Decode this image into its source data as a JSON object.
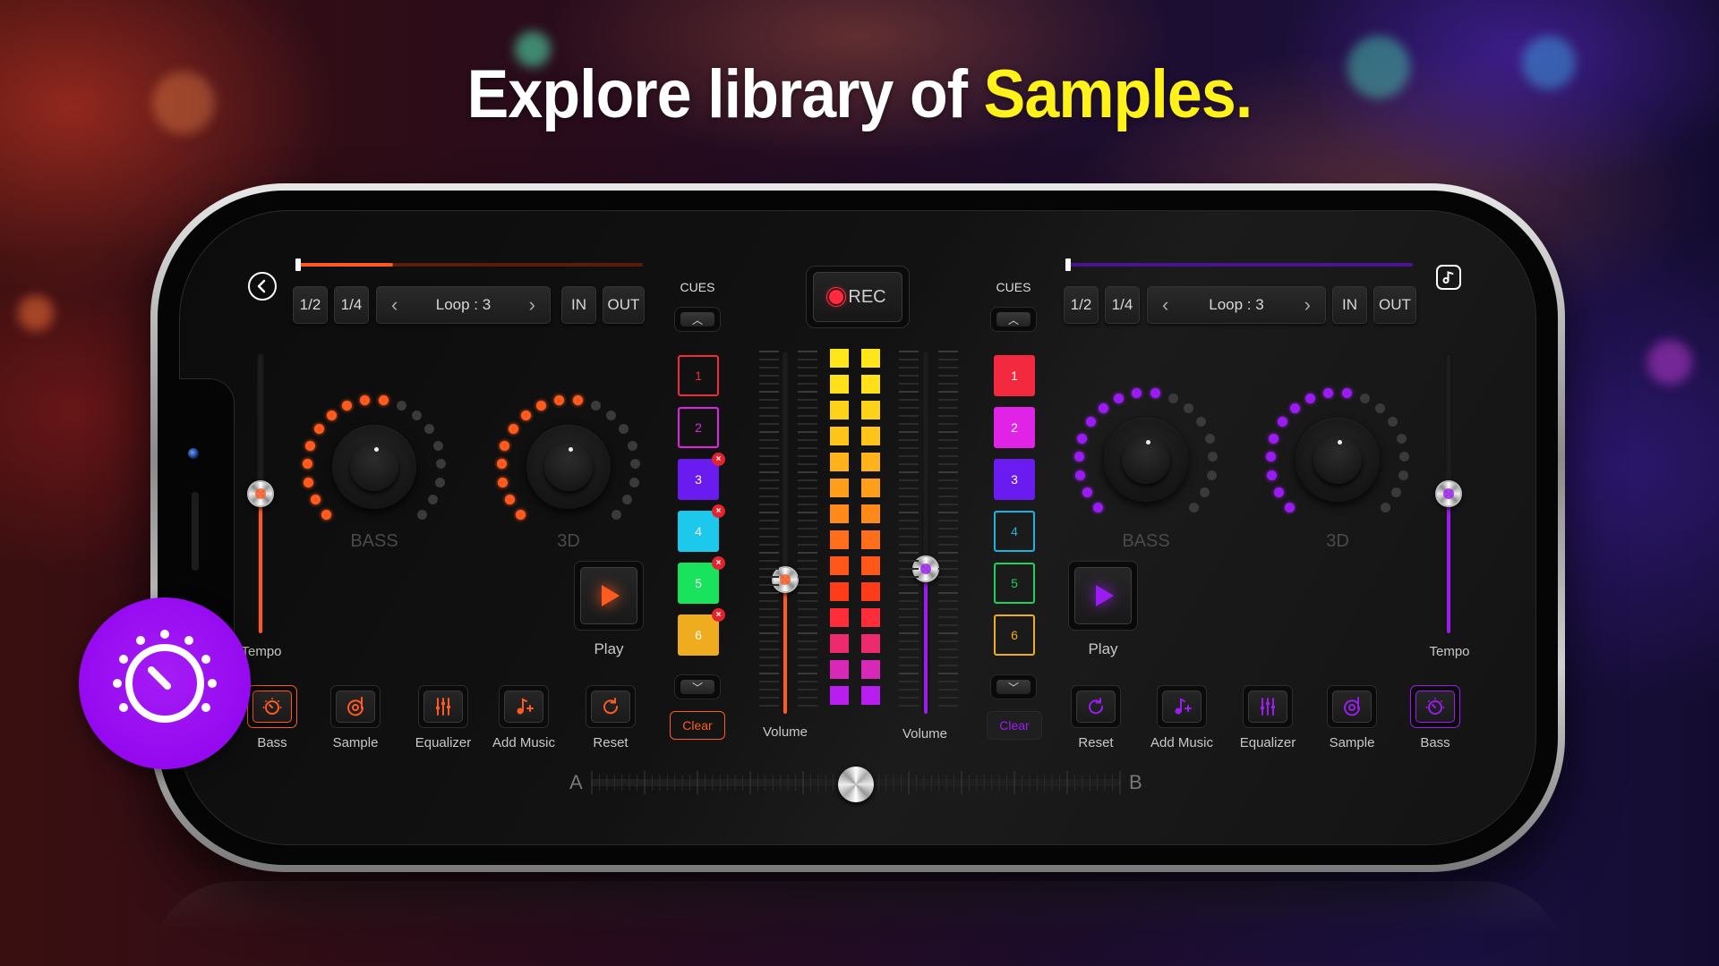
{
  "headline": {
    "text": "Explore library of ",
    "highlight": "Samples."
  },
  "colors": {
    "left_accent": "#ff5a1f",
    "right_accent": "#9b1cf0",
    "headline_highlight": "#fff21a",
    "rec_dot": "#ff2a40",
    "badge": "#9a10f2"
  },
  "rec": {
    "label": "REC"
  },
  "decks": {
    "left": {
      "progress": 0.28,
      "loop_controls": {
        "half": "1/2",
        "quarter": "1/4",
        "loop_label": "Loop : 3",
        "prev": "‹",
        "next": "›",
        "in": "IN",
        "out": "OUT"
      },
      "nav_icon": "back-circle-icon",
      "knobs": [
        {
          "label": "BASS",
          "lit_dots": 10,
          "total_dots": 18
        },
        {
          "label": "3D",
          "lit_dots": 10,
          "total_dots": 18
        }
      ],
      "tempo": {
        "label": "Tempo",
        "value": 0.5
      },
      "play_label": "Play",
      "cues": {
        "title": "CUES",
        "pads": [
          {
            "num": "1",
            "color": "#f2293f",
            "filled": false,
            "removable": false
          },
          {
            "num": "2",
            "color": "#e123e8",
            "filled": false,
            "removable": false
          },
          {
            "num": "3",
            "color": "#6a1cf0",
            "filled": true,
            "removable": true
          },
          {
            "num": "4",
            "color": "#1cc8ec",
            "filled": true,
            "removable": true
          },
          {
            "num": "5",
            "color": "#19e35c",
            "filled": true,
            "removable": true
          },
          {
            "num": "6",
            "color": "#f0ac1f",
            "filled": true,
            "removable": true
          }
        ],
        "clear_label": "Clear"
      },
      "volume": {
        "label": "Volume",
        "value": 0.37
      },
      "functions": [
        {
          "label": "Bass",
          "icon": "bass-knob-icon",
          "active": true
        },
        {
          "label": "Sample",
          "icon": "sample-disc-icon",
          "active": false
        },
        {
          "label": "Equalizer",
          "icon": "equalizer-icon",
          "active": false
        },
        {
          "label": "Add Music",
          "icon": "add-music-icon",
          "active": false
        },
        {
          "label": "Reset",
          "icon": "reset-icon",
          "active": false
        }
      ]
    },
    "right": {
      "progress": 0.0,
      "loop_controls": {
        "half": "1/2",
        "quarter": "1/4",
        "loop_label": "Loop : 3",
        "prev": "‹",
        "next": "›",
        "in": "IN",
        "out": "OUT"
      },
      "nav_icon": "music-library-icon",
      "knobs": [
        {
          "label": "BASS",
          "lit_dots": 10,
          "total_dots": 18
        },
        {
          "label": "3D",
          "lit_dots": 10,
          "total_dots": 18
        }
      ],
      "tempo": {
        "label": "Tempo",
        "value": 0.5
      },
      "play_label": "Play",
      "cues": {
        "title": "CUES",
        "pads": [
          {
            "num": "1",
            "color": "#f2293f",
            "filled": true,
            "removable": false
          },
          {
            "num": "2",
            "color": "#e123e8",
            "filled": true,
            "removable": false
          },
          {
            "num": "3",
            "color": "#6a1cf0",
            "filled": true,
            "removable": false
          },
          {
            "num": "4",
            "color": "#1cb4dc",
            "filled": false,
            "removable": false
          },
          {
            "num": "5",
            "color": "#19d35c",
            "filled": false,
            "removable": false
          },
          {
            "num": "6",
            "color": "#f0ac1f",
            "filled": false,
            "removable": false
          }
        ],
        "clear_label": "Clear"
      },
      "volume": {
        "label": "Volume",
        "value": 0.4
      },
      "functions": [
        {
          "label": "Reset",
          "icon": "reset-icon",
          "active": false
        },
        {
          "label": "Add Music",
          "icon": "add-music-icon",
          "active": false
        },
        {
          "label": "Equalizer",
          "icon": "equalizer-icon",
          "active": false
        },
        {
          "label": "Sample",
          "icon": "sample-disc-icon",
          "active": false
        },
        {
          "label": "Bass",
          "icon": "bass-knob-icon",
          "active": true
        }
      ]
    }
  },
  "meter": {
    "rows": 14,
    "colors": [
      "#ffe61a",
      "#ffe01a",
      "#ffd21a",
      "#ffc41a",
      "#ffb21a",
      "#ff9e1a",
      "#ff8a1a",
      "#ff6e1a",
      "#ff561a",
      "#ff3c1a",
      "#ff2d3a",
      "#ee2a6e",
      "#d828b8",
      "#b81ef0"
    ]
  },
  "crossfader": {
    "left_label": "A",
    "right_label": "B",
    "value": 0.5
  },
  "feature_badge": {
    "icon": "bass-knob-icon"
  }
}
